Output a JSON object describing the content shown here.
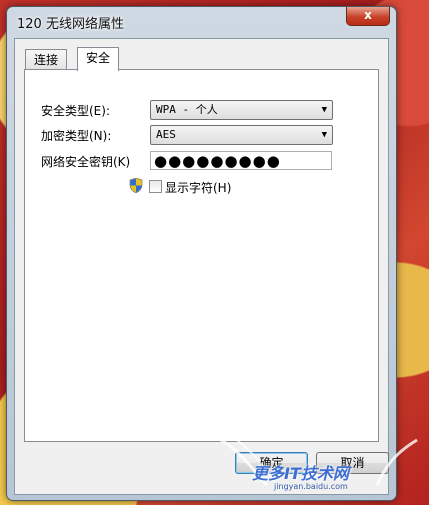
{
  "window": {
    "title": "120 无线网络属性",
    "close_label": "x"
  },
  "tabs": [
    {
      "label": "连接",
      "active": false
    },
    {
      "label": "安全",
      "active": true
    }
  ],
  "security": {
    "security_type_label": "安全类型(E):",
    "security_type_value": "WPA - 个人",
    "encryption_type_label": "加密类型(N):",
    "encryption_type_value": "AES",
    "key_label": "网络安全密钥(K)",
    "key_value": "●●●●●●●●●",
    "show_chars_label": "显示字符(H)",
    "show_chars_checked": false
  },
  "buttons": {
    "ok": "确定",
    "cancel": "取消"
  },
  "watermark": {
    "text": "更多IT技术网",
    "url": "jingyan.baidu.com"
  },
  "icons": {
    "dropdown": "chevron-down-icon",
    "uac": "uac-shield-icon"
  }
}
